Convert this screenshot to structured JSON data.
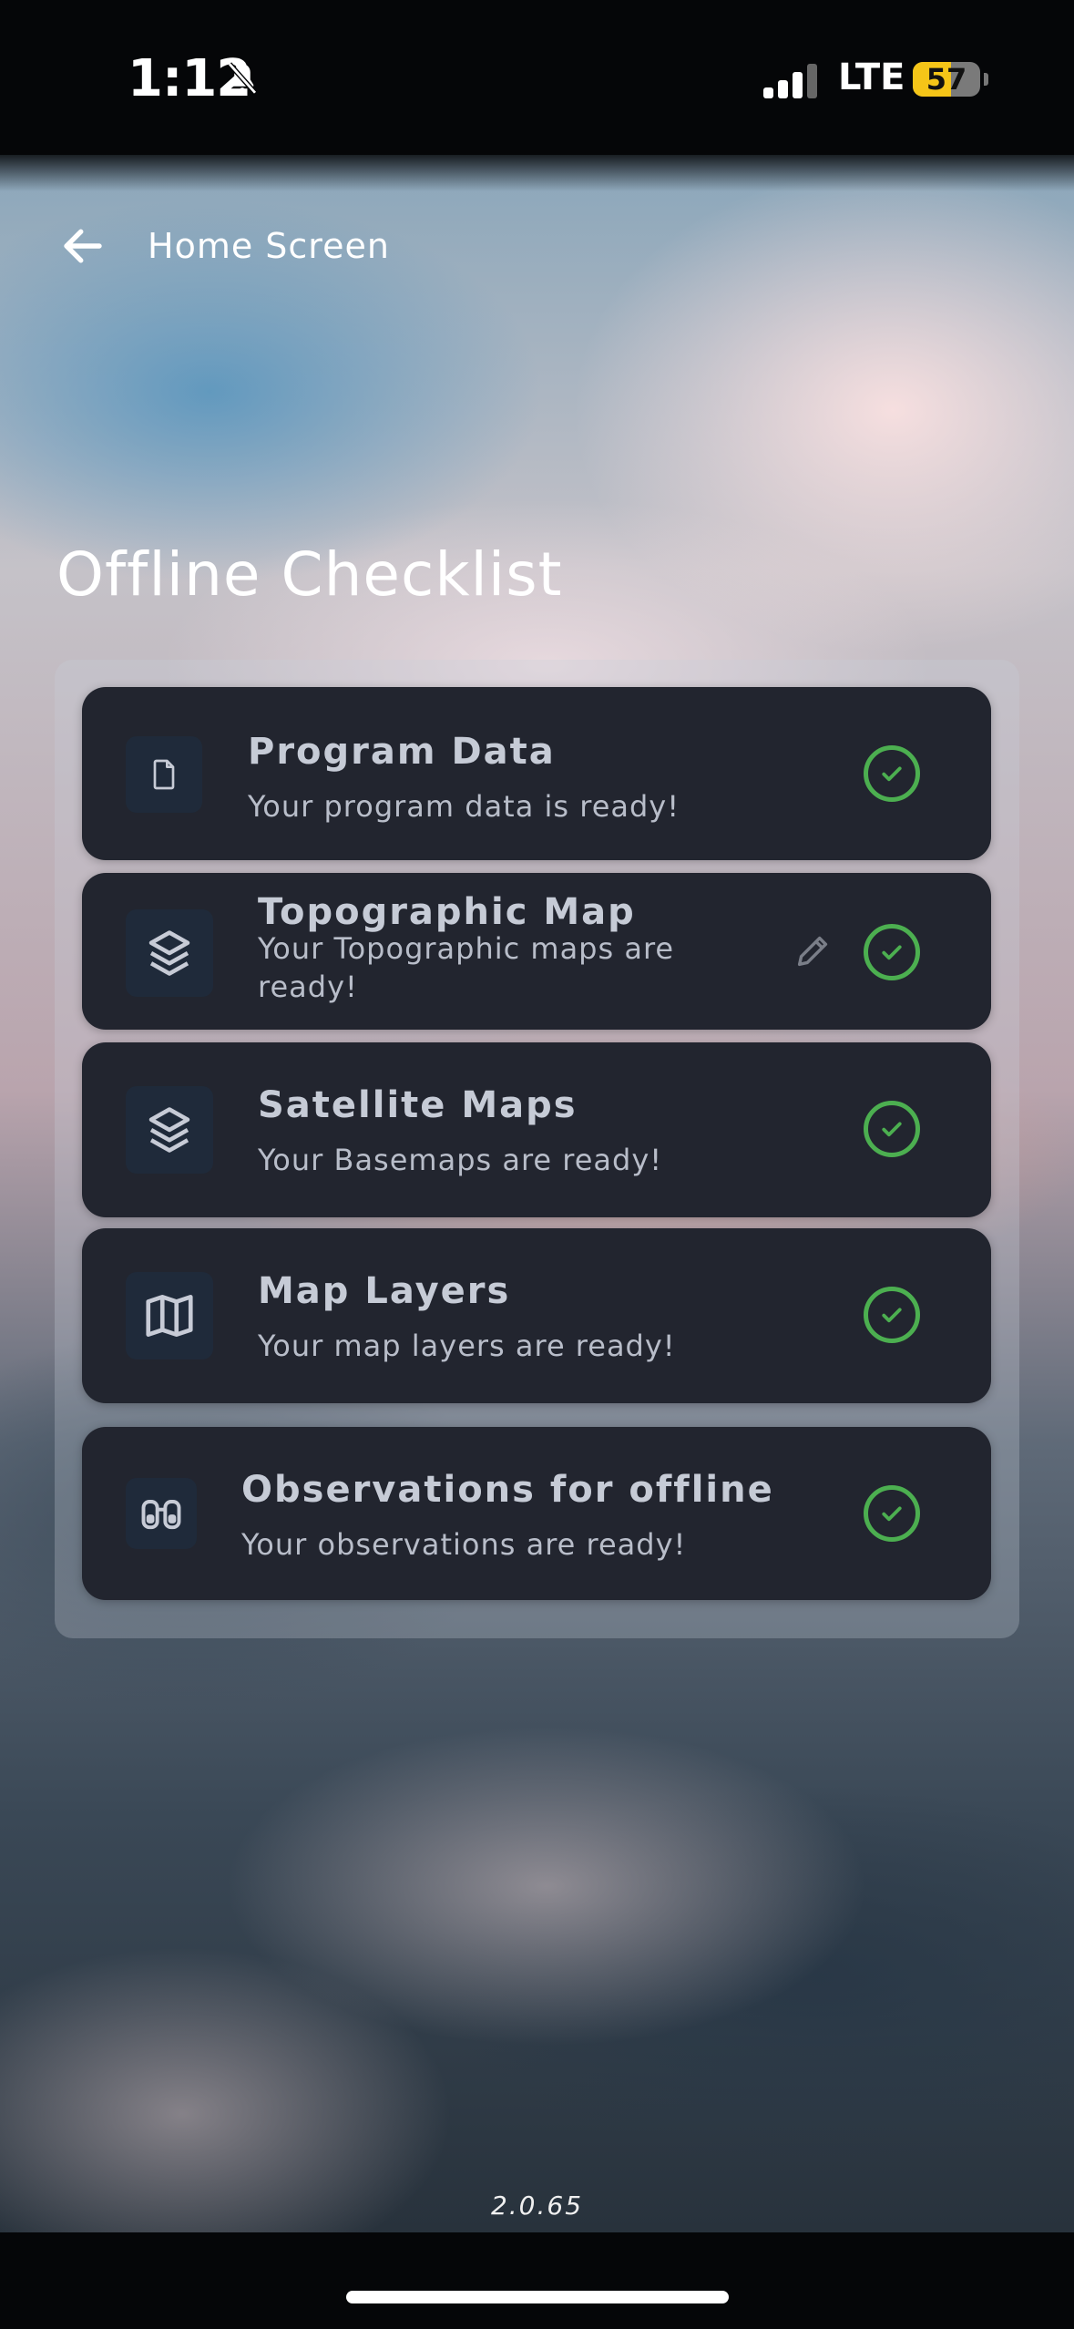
{
  "status_bar": {
    "time": "1:12",
    "network": "LTE",
    "battery": "57",
    "battery_level": 0.57,
    "signal_bars": 3
  },
  "nav": {
    "back_label": "Home Screen"
  },
  "page": {
    "title": "Offline Checklist"
  },
  "checklist": [
    {
      "title": "Program Data",
      "subtitle": "Your program data is ready!",
      "icon": "file-icon",
      "status": "ready"
    },
    {
      "title": "Topographic Map",
      "subtitle": "Your Topographic maps are ready!",
      "icon": "layers-icon",
      "status": "ready",
      "editable": true
    },
    {
      "title": "Satellite Maps",
      "subtitle": "Your Basemaps are ready!",
      "icon": "layers-icon",
      "status": "ready"
    },
    {
      "title": "Map Layers",
      "subtitle": "Your map layers are ready!",
      "icon": "map-icon",
      "status": "ready"
    },
    {
      "title": "Observations for offline",
      "subtitle": "Your observations are ready!",
      "icon": "binoculars-icon",
      "status": "ready"
    }
  ],
  "footer": {
    "version": "2.0.65"
  },
  "colors": {
    "card_bg": "#22252f",
    "check_green": "#4caf50",
    "icon_box_bg": "#1f2a3a"
  }
}
